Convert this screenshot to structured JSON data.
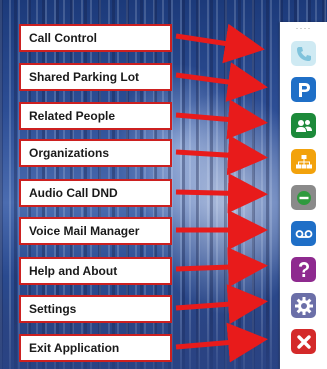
{
  "items": [
    {
      "label": "Call Control",
      "icon": "phone-icon",
      "color": "#cfeaf3",
      "glyph": "✆"
    },
    {
      "label": "Shared Parking Lot",
      "icon": "parking-icon",
      "color": "#1f6fc7",
      "glyph": "P"
    },
    {
      "label": "Related People",
      "icon": "contacts-icon",
      "color": "#1c8a3a",
      "glyph": "👥"
    },
    {
      "label": "Organizations",
      "icon": "org-chart-icon",
      "color": "#f2a20c",
      "glyph": "品"
    },
    {
      "label": "Audio Call DND",
      "icon": "dnd-icon",
      "color": "#8a8a8a",
      "glyph": "⊖"
    },
    {
      "label": "Voice Mail Manager",
      "icon": "voicemail-icon",
      "color": "#1f6fc7",
      "glyph": "oo"
    },
    {
      "label": "Help and About",
      "icon": "help-icon",
      "color": "#8e2a8f",
      "glyph": "?"
    },
    {
      "label": "Settings",
      "icon": "gear-icon",
      "color": "#6b6fa8",
      "glyph": "⚙"
    },
    {
      "label": "Exit Application",
      "icon": "close-icon",
      "color": "#d42a2a",
      "glyph": "✖"
    }
  ],
  "sidebar": {
    "handle": "····"
  },
  "colors": {
    "label_border": "#cc2020",
    "arrow": "#e81b1b"
  }
}
